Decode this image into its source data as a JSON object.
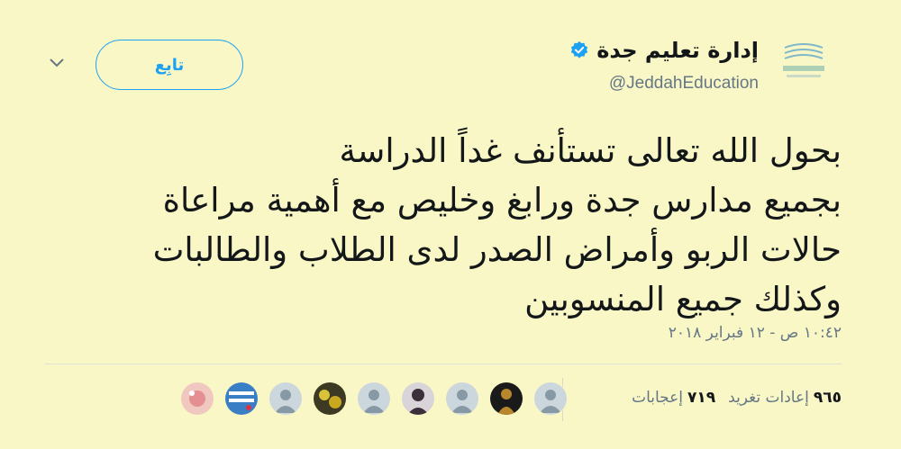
{
  "author": {
    "name": "إدارة تعليم جدة",
    "handle": "@JeddahEducation",
    "verified": true
  },
  "follow_button": {
    "label": "تابِع"
  },
  "tweet": {
    "lines": [
      "بحول الله تعالى تستأنف غداً الدراسة",
      "بجميع مدارس جدة ورابغ وخليص مع أهمية مراعاة",
      "حالات الربو وأمراض الصدر لدى الطلاب والطالبات",
      "وكذلك جميع المنسوبين"
    ],
    "timestamp": "١٠:٤٢ ص - ١٢ فبراير ٢٠١٨"
  },
  "stats": {
    "retweets_count": "٩٦٥",
    "retweets_label": "إعادات تغريد",
    "likes_count": "٧١٩",
    "likes_label": "إعجابات"
  },
  "likers": [
    {
      "icon": "default-avatar-icon"
    },
    {
      "icon": "user-avatar-icon"
    },
    {
      "icon": "default-avatar-icon"
    },
    {
      "icon": "user-avatar-icon"
    },
    {
      "icon": "default-avatar-icon"
    },
    {
      "icon": "user-avatar-icon"
    },
    {
      "icon": "default-avatar-icon"
    },
    {
      "icon": "user-avatar-icon"
    },
    {
      "icon": "user-avatar-icon"
    }
  ],
  "colors": {
    "background": "#f9f7c5",
    "accent": "#1da1f2",
    "text": "#14171a",
    "muted": "#657786"
  }
}
